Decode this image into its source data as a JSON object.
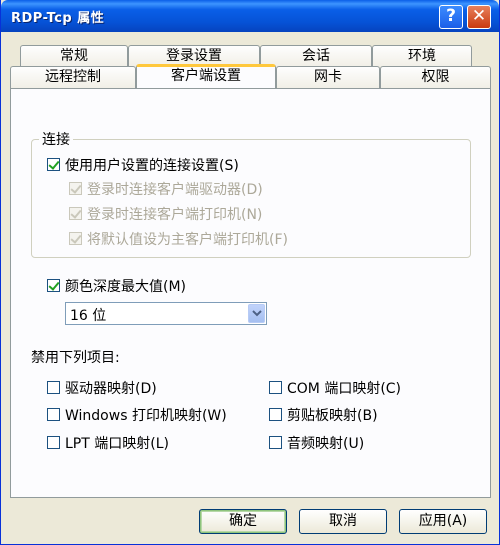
{
  "window": {
    "title": "RDP-Tcp 属性",
    "help_glyph": "?",
    "close_glyph": "✕"
  },
  "tabs": {
    "row1": [
      "常规",
      "登录设置",
      "会话",
      "环境"
    ],
    "row2": [
      "远程控制",
      "客户端设置",
      "网卡",
      "权限"
    ],
    "active": "客户端设置"
  },
  "connection": {
    "legend": "连接",
    "use_user_settings": {
      "label": "使用用户设置的连接设置(S)",
      "checked": true
    },
    "sub_options": [
      {
        "label": "登录时连接客户端驱动器(D)",
        "checked": true,
        "disabled": true
      },
      {
        "label": "登录时连接客户端打印机(N)",
        "checked": true,
        "disabled": true
      },
      {
        "label": "将默认值设为主客户端打印机(F)",
        "checked": true,
        "disabled": true
      }
    ]
  },
  "color_depth": {
    "label": "颜色深度最大值(M)",
    "checked": true,
    "selected": "16 位"
  },
  "disable_items": {
    "title": "禁用下列项目:",
    "items": [
      {
        "label": "驱动器映射(D)",
        "checked": false
      },
      {
        "label": "COM 端口映射(C)",
        "checked": false
      },
      {
        "label": "Windows 打印机映射(W)",
        "checked": false
      },
      {
        "label": "剪贴板映射(B)",
        "checked": false
      },
      {
        "label": "LPT 端口映射(L)",
        "checked": false
      },
      {
        "label": "音频映射(U)",
        "checked": false
      }
    ]
  },
  "buttons": {
    "ok": "确定",
    "cancel": "取消",
    "apply": "应用(A)"
  }
}
